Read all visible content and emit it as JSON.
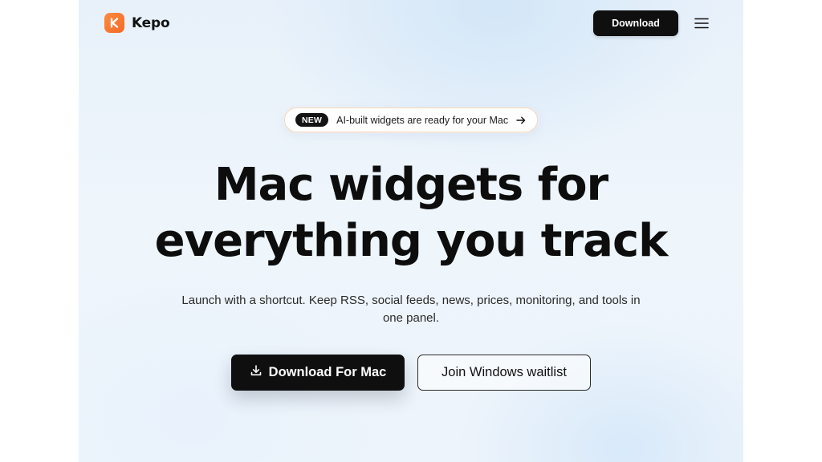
{
  "header": {
    "brand": "Kepo",
    "download_label": "Download",
    "logo_icon": "kepo-logo-icon",
    "menu_icon": "hamburger-menu-icon"
  },
  "announcement": {
    "badge": "NEW",
    "text": "AI-built widgets are ready for your Mac",
    "arrow_icon": "arrow-right-icon"
  },
  "hero": {
    "headline_line1": "Mac widgets for",
    "headline_line2": "everything you track",
    "subtitle": "Launch with a shortcut. Keep RSS, social feeds, news, prices, monitoring, and tools in one panel."
  },
  "cta": {
    "primary_label": "Download For Mac",
    "primary_icon": "download-icon",
    "secondary_label": "Join Windows waitlist"
  },
  "colors": {
    "brand_orange": "#f26b2a",
    "button_dark": "#0f0f10",
    "background": "#edf4fb"
  }
}
